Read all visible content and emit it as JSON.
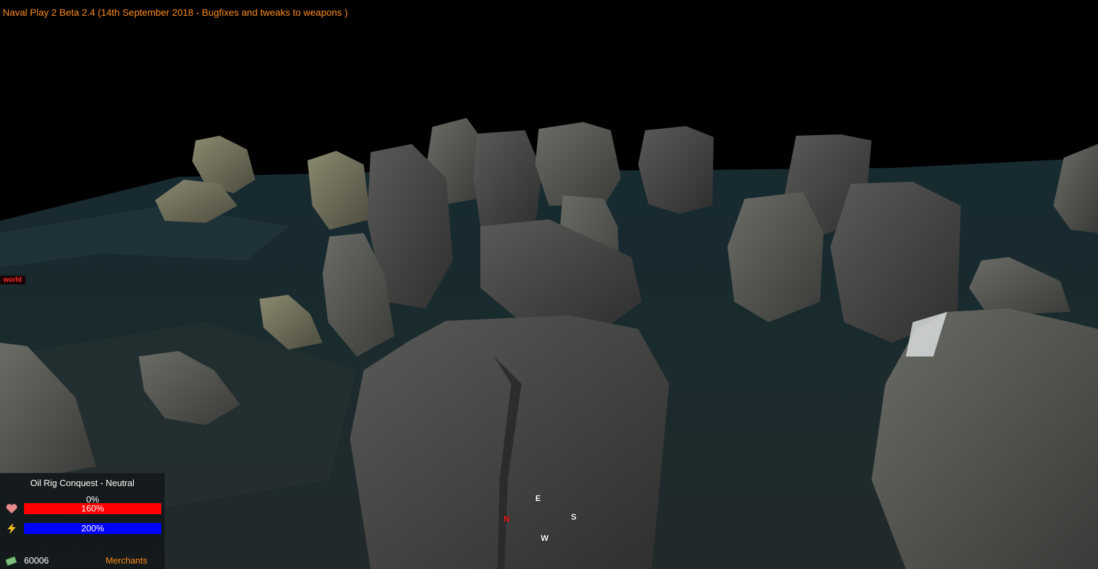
{
  "game": {
    "title": "Naval Play 2 Beta 2.4 (14th September 2018 - Bugfixes and tweaks to weapons )",
    "world_label": "world"
  },
  "hud": {
    "mode_title": "Oil Rig Conquest - Neutral",
    "capture_progress": "0%",
    "health": {
      "label": "160%",
      "fill_fraction": 1.0,
      "color": "#ff0000",
      "icon": "heart-icon"
    },
    "energy": {
      "label": "200%",
      "fill_fraction": 1.0,
      "color": "#0000ff",
      "icon": "lightning-icon"
    },
    "money": {
      "value": "60006",
      "icon": "money-icon"
    },
    "faction": "Merchants"
  },
  "compass": {
    "north": "N",
    "east": "E",
    "south": "S",
    "west": "W",
    "north_color": "#ff2020"
  },
  "colors": {
    "title_accent": "#ff8c1a",
    "sky": "#000000",
    "water": "#1c2b30"
  }
}
